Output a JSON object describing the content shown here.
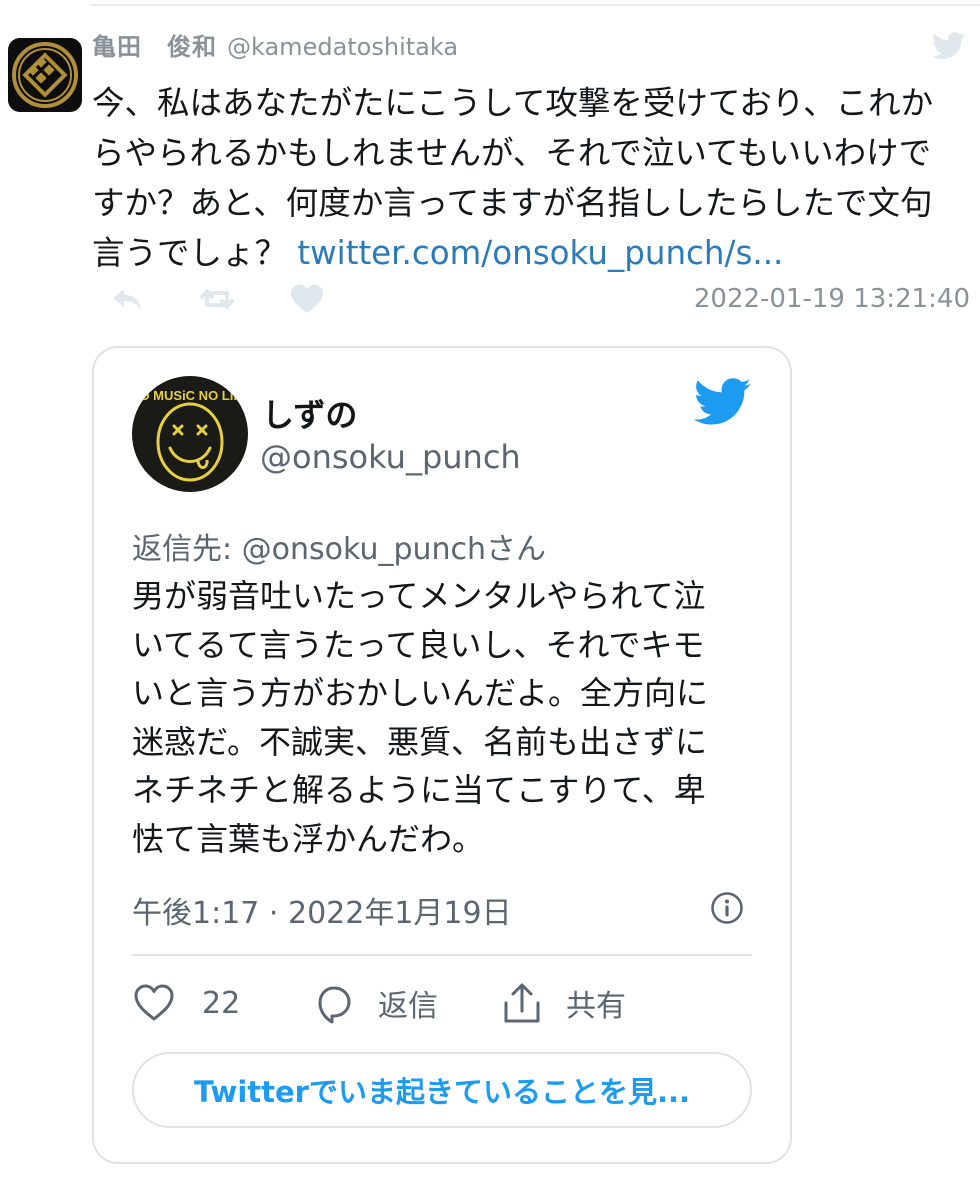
{
  "outer_tweet": {
    "author_name": "亀田　俊和",
    "author_handle": "@kamedatoshitaka",
    "text_line1": "今、私はあなたがたにこうして攻撃を受けており、これか",
    "text_line2": "らやられるかもしれませんが、それで泣いてもいいわけで",
    "text_line3": "すか？あと、何度か言ってますが名指ししたらしたで文句",
    "text_line4_prefix": "言うでしょ？ ",
    "link_text": "twitter.com/onsoku_punch/s...",
    "timestamp": "2022-01-19 13:21:40",
    "icons": [
      "reply-icon",
      "retweet-icon",
      "like-icon",
      "twitter-bird-icon"
    ]
  },
  "embedded_tweet": {
    "avatar_text": "NO MUSiC NO LIFE",
    "author_name": "しずの",
    "author_handle": "@onsoku_punch",
    "reply_to": "返信先: @onsoku_punchさん",
    "text_lines": [
      "男が弱音吐いたってメンタルやられて泣",
      "いてるて言うたって良いし、それでキモ",
      "いと言う方がおかしいんだよ。全方向に",
      "迷惑だ。不誠実、悪質、名前も出さずに",
      "ネチネチと解るように当てこすりて、卑",
      "怯て言葉も浮かんだわ。"
    ],
    "time": "午後1:17 · 2022年1月19日",
    "like_count": "22",
    "reply_label": "返信",
    "share_label": "共有",
    "cta_label": "Twitterでいま起きていることを見...",
    "icons": [
      "heart-icon",
      "comment-icon",
      "share-icon",
      "info-icon",
      "twitter-bird-icon"
    ]
  },
  "colors": {
    "link": "#2b7bb9",
    "twitter_blue": "#1d9bf0",
    "muted_text": "#8a9299",
    "card_border": "#dfe3e8",
    "avatar_gold": "#b08f3a"
  }
}
